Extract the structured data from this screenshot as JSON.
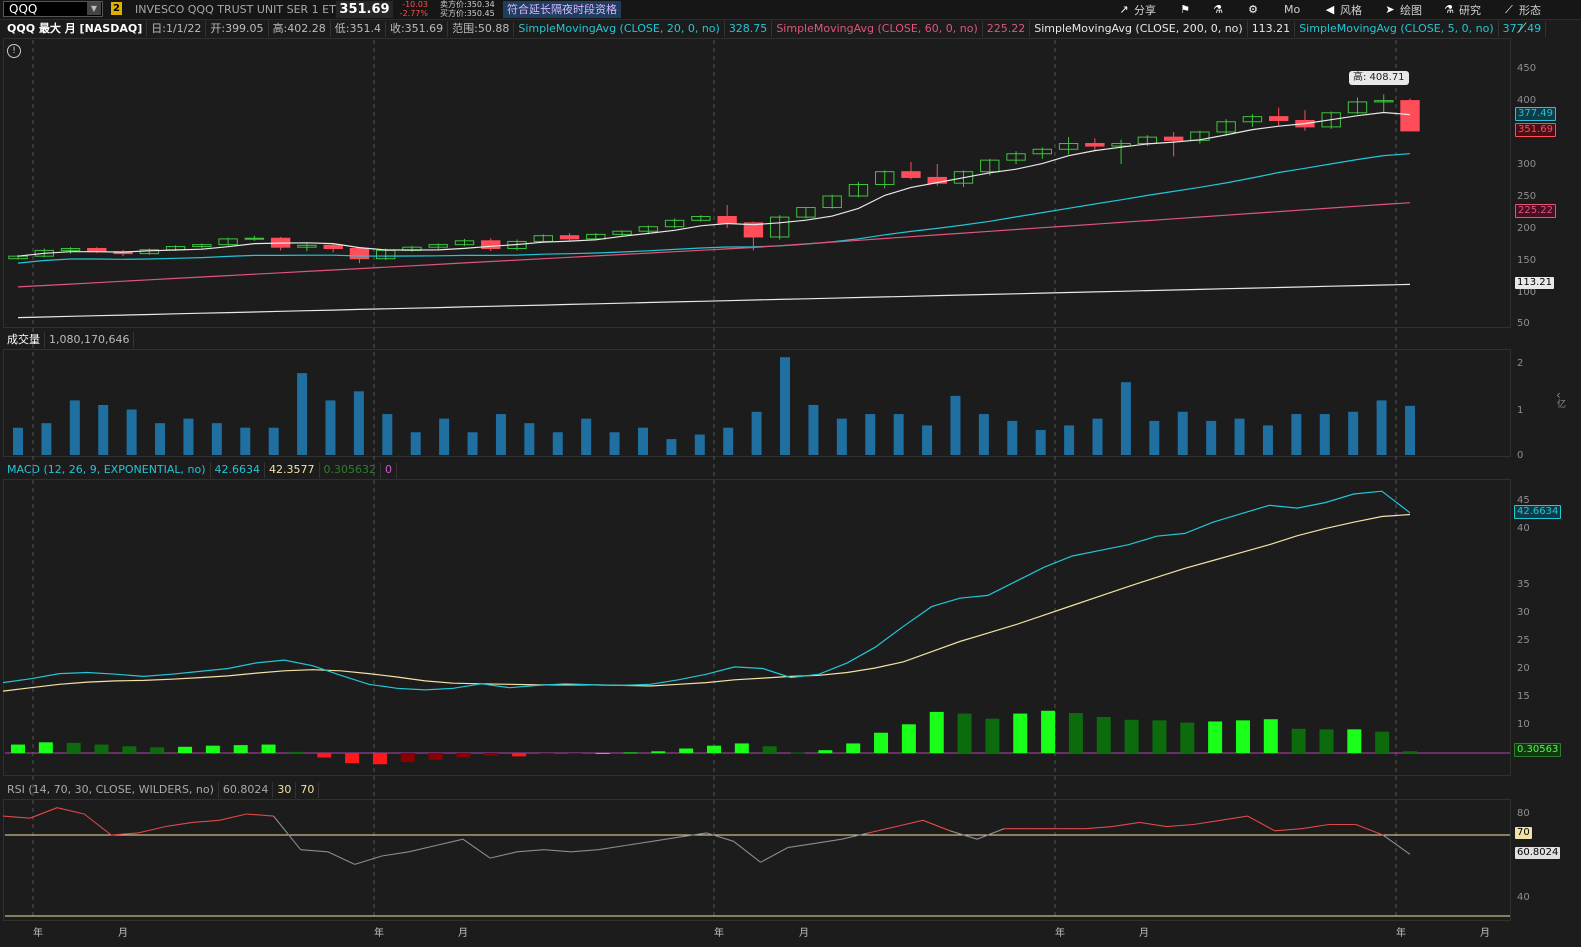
{
  "toolbar": {
    "symbol": "QQQ",
    "link_number": "2",
    "description": "INVESCO QQQ TRUST UNIT SER 1 ETF",
    "last_price": "351.69",
    "net_change": "-10.03",
    "pct_change": "-2.77%",
    "bid": "卖方价:350.34",
    "ask": "买方价:350.45",
    "notice": "符合延长隔夜时段资格",
    "share_label": "分享",
    "mo_label": "Mo",
    "style_label": "风格",
    "draw_label": "绘图",
    "research_label": "研究",
    "patterns_label": "形态",
    "icons": [
      "share-icon",
      "flag-icon",
      "flask-icon",
      "gear-icon",
      "speaker-icon",
      "cursor-icon",
      "flask-icon",
      "pattern-icon"
    ]
  },
  "price_legend": {
    "title": "QQQ 最大 月 [NASDAQ]",
    "date": "日:1/1/22",
    "open": "开:399.05",
    "high": "高:402.28",
    "low": "低:351.4",
    "close": "收:351.69",
    "range": "范围:50.88",
    "sma20_label": "SimpleMovingAvg (CLOSE, 20, 0, no)",
    "sma20_value": "328.75",
    "sma60_label": "SimpleMovingAvg (CLOSE, 60, 0, no)",
    "sma60_value": "225.22",
    "sma200_label": "SimpleMovingAvg (CLOSE, 200, 0, no)",
    "sma200_value": "113.21",
    "sma5_label": "SimpleMovingAvg (CLOSE, 5, 0, no)",
    "sma5_value": "377.49"
  },
  "price_panel": {
    "axis_ticks": [
      "450",
      "400",
      "350",
      "300",
      "250",
      "200",
      "150",
      "100",
      "50"
    ],
    "high_callout": "高: 408.71",
    "tag_sma5": "377.49",
    "tag_close": "351.69",
    "tag_sma60": "225.22",
    "tag_sma200": "113.21",
    "colors": {
      "up": "#3ec43e",
      "down": "#ff4d5a",
      "sma5": "#e8e8e8",
      "sma20": "#22c6d6",
      "sma60": "#e0557a",
      "sma200": "#e8e8e8"
    }
  },
  "volume_legend": {
    "label": "成交量",
    "value": "1,080,170,646"
  },
  "volume_panel": {
    "axis_ticks": [
      "2",
      "1",
      "0"
    ],
    "unit": "亿",
    "color": "#1f6fa0"
  },
  "macd_legend": {
    "label": "MACD (12, 26, 9, EXPONENTIAL, no)",
    "value": "42.6634",
    "avg": "42.3577",
    "diff": "0.305632",
    "zero": "0"
  },
  "macd_panel": {
    "axis_ticks": [
      "45",
      "40",
      "35",
      "30",
      "25",
      "20",
      "15",
      "10",
      "5"
    ],
    "tag_value": "42.6634",
    "tag_diff": "0.30563"
  },
  "rsi_legend": {
    "label": "RSI (14, 70, 30, CLOSE, WILDERS, no)",
    "value": "60.8024",
    "oversold": "30",
    "overbought": "70"
  },
  "rsi_panel": {
    "axis_ticks": [
      "80",
      "40"
    ],
    "tag_ob": "70",
    "tag_value": "60.8024"
  },
  "x_axis": {
    "labels": [
      "年",
      "月",
      "年",
      "月",
      "年",
      "月",
      "年",
      "月",
      "年",
      "月"
    ]
  },
  "chart_data": {
    "type": "candlestick",
    "title": "QQQ 最大 月 [NASDAQ]",
    "ylim": [
      50,
      450
    ],
    "candles": [
      [
        152,
        158,
        151,
        156
      ],
      [
        156,
        168,
        154,
        165
      ],
      [
        165,
        170,
        160,
        168
      ],
      [
        168,
        170,
        161,
        163
      ],
      [
        163,
        166,
        156,
        160
      ],
      [
        160,
        168,
        158,
        166
      ],
      [
        166,
        173,
        164,
        171
      ],
      [
        171,
        176,
        168,
        174
      ],
      [
        174,
        185,
        172,
        183
      ],
      [
        183,
        188,
        180,
        184
      ],
      [
        184,
        186,
        165,
        170
      ],
      [
        170,
        176,
        164,
        173
      ],
      [
        173,
        176,
        162,
        168
      ],
      [
        168,
        170,
        145,
        152
      ],
      [
        152,
        168,
        150,
        165
      ],
      [
        165,
        172,
        163,
        170
      ],
      [
        170,
        176,
        167,
        174
      ],
      [
        174,
        183,
        172,
        180
      ],
      [
        180,
        184,
        164,
        168
      ],
      [
        168,
        182,
        165,
        179
      ],
      [
        179,
        190,
        177,
        188
      ],
      [
        188,
        192,
        180,
        183
      ],
      [
        183,
        192,
        181,
        190
      ],
      [
        190,
        196,
        188,
        195
      ],
      [
        195,
        204,
        190,
        202
      ],
      [
        202,
        215,
        200,
        212
      ],
      [
        212,
        220,
        210,
        218
      ],
      [
        218,
        236,
        200,
        208
      ],
      [
        208,
        210,
        165,
        186
      ],
      [
        186,
        220,
        182,
        217
      ],
      [
        217,
        233,
        215,
        232
      ],
      [
        232,
        252,
        230,
        250
      ],
      [
        250,
        272,
        248,
        268
      ],
      [
        268,
        290,
        262,
        288
      ],
      [
        288,
        303,
        276,
        279
      ],
      [
        279,
        300,
        266,
        270
      ],
      [
        270,
        290,
        264,
        288
      ],
      [
        288,
        308,
        282,
        306
      ],
      [
        306,
        320,
        300,
        316
      ],
      [
        316,
        326,
        308,
        323
      ],
      [
        323,
        342,
        315,
        332
      ],
      [
        332,
        340,
        320,
        328
      ],
      [
        328,
        338,
        300,
        332
      ],
      [
        332,
        345,
        328,
        342
      ],
      [
        342,
        350,
        312,
        337
      ],
      [
        337,
        352,
        332,
        350
      ],
      [
        350,
        370,
        345,
        366
      ],
      [
        366,
        378,
        358,
        374
      ],
      [
        374,
        388,
        360,
        368
      ],
      [
        368,
        384,
        352,
        358
      ],
      [
        358,
        382,
        355,
        380
      ],
      [
        380,
        404,
        378,
        397
      ],
      [
        397,
        408.71,
        380,
        399
      ],
      [
        399.05,
        402.28,
        351.4,
        351.69
      ]
    ],
    "volume_e8": [
      0.6,
      0.7,
      1.2,
      1.1,
      1.0,
      0.7,
      0.8,
      0.7,
      0.6,
      0.6,
      1.8,
      1.2,
      1.4,
      0.9,
      0.5,
      0.8,
      0.5,
      0.9,
      0.7,
      0.5,
      0.8,
      0.5,
      0.6,
      0.35,
      0.45,
      0.6,
      0.95,
      2.15,
      1.1,
      0.8,
      0.9,
      0.9,
      0.65,
      1.3,
      0.9,
      0.75,
      0.55,
      0.65,
      0.8,
      1.6,
      0.75,
      0.95,
      0.75,
      0.8,
      0.65,
      0.9,
      0.9,
      0.95,
      1.2,
      1.08
    ],
    "macd": [
      12.5,
      13.2,
      14.1,
      14.3,
      14.0,
      13.6,
      14.0,
      14.5,
      15.0,
      16.0,
      16.5,
      15.5,
      13.8,
      12.2,
      11.5,
      11.2,
      11.5,
      12.3,
      11.6,
      12.0,
      12.3,
      12.1,
      12.0,
      12.2,
      13.0,
      14.0,
      15.3,
      15.0,
      13.4,
      14.0,
      16.0,
      18.8,
      22.5,
      26.0,
      27.5,
      28.0,
      30.5,
      33.0,
      35.0,
      36.0,
      37.0,
      38.5,
      39.0,
      41.0,
      42.5,
      44.0,
      43.5,
      44.5,
      46.0,
      46.5,
      42.66
    ],
    "macd_avg": [
      11.0,
      11.6,
      12.2,
      12.6,
      12.8,
      12.9,
      13.1,
      13.4,
      13.7,
      14.2,
      14.6,
      14.8,
      14.6,
      14.1,
      13.5,
      12.8,
      12.4,
      12.3,
      12.2,
      12.1,
      12.1,
      12.1,
      12.0,
      11.9,
      12.2,
      12.5,
      13.0,
      13.3,
      13.6,
      13.8,
      14.3,
      15.1,
      16.2,
      18.0,
      19.8,
      21.3,
      22.8,
      24.5,
      26.2,
      27.9,
      29.6,
      31.2,
      32.8,
      34.2,
      35.6,
      37.0,
      38.6,
      39.9,
      41.0,
      42.0,
      42.36
    ],
    "macd_diff": [
      1.5,
      1.9,
      1.8,
      1.5,
      1.2,
      1.0,
      1.1,
      1.3,
      1.4,
      1.5,
      0.2,
      -0.8,
      -1.8,
      -2.0,
      -1.6,
      -1.2,
      -0.8,
      -0.5,
      -0.6,
      -0.2,
      -0.1,
      0.0,
      0.1,
      0.3,
      0.8,
      1.3,
      1.7,
      1.2,
      0.1,
      0.5,
      1.7,
      3.6,
      5.1,
      7.3,
      7.0,
      6.1,
      7.0,
      7.5,
      7.1,
      6.4,
      5.9,
      5.8,
      5.4,
      5.6,
      5.8,
      6.0,
      4.3,
      4.2,
      4.2,
      3.8,
      0.31
    ],
    "rsi": [
      79,
      78,
      83,
      80,
      70,
      71,
      74,
      76,
      77,
      80,
      79,
      63,
      62,
      56,
      60,
      62,
      65,
      68,
      59,
      62,
      63,
      62,
      63,
      65,
      67,
      69,
      71,
      67,
      57,
      64,
      66,
      68,
      71,
      74,
      77,
      72,
      68,
      73,
      73,
      73,
      73,
      74,
      76,
      74,
      75,
      77,
      79,
      72,
      73,
      75,
      75,
      70,
      60.8
    ]
  }
}
